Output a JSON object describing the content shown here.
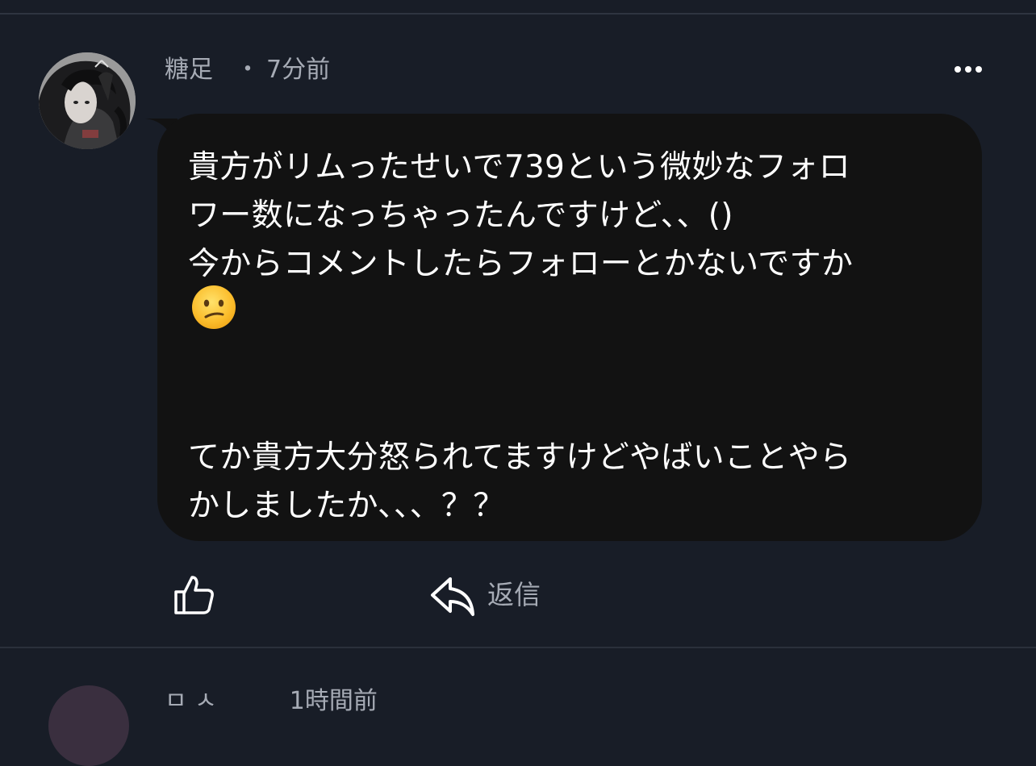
{
  "comment": {
    "author": "糖足",
    "separator": "・",
    "time": "7分前",
    "text": "貴方がリムったせいで739という微妙なフォロ\nワー数になっちゃったんですけど、、()\n今からコメントしたらフォローとかないですか\n\n\n\nてか貴方大分怒られてますけどやばいことやら\nかしましたか、、、？？",
    "emoji": "confused-face"
  },
  "actions": {
    "like_icon": "thumbs-up-icon",
    "reply_icon": "reply-arrow-icon",
    "reply_label": "返信",
    "more_icon": "more-horizontal-icon"
  },
  "next_comment": {
    "header_partial": "ㅁ ㅅ　　　1時間前"
  },
  "colors": {
    "background": "#181d27",
    "bubble": "#121212",
    "muted_text": "#a6abb5",
    "text": "#ffffff"
  }
}
